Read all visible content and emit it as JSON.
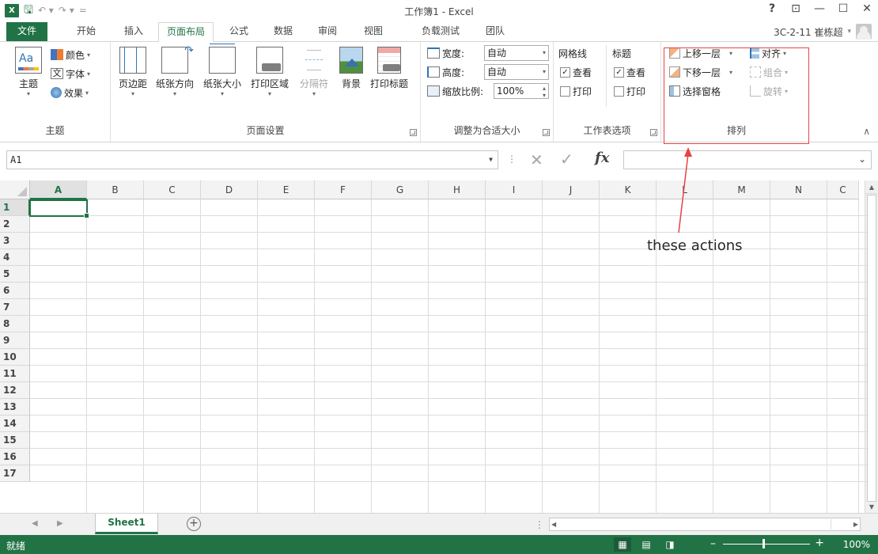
{
  "app": {
    "title": "工作簿1 - Excel",
    "help": "?",
    "accent": "#217346"
  },
  "qat": {
    "logo": "X",
    "save": "🖫",
    "undo": "↶ ▾",
    "redo": "↷ ▾",
    "customize": "="
  },
  "window": {
    "restore_ribbon": "⊡",
    "minimize": "—",
    "maximize": "☐",
    "close": "✕"
  },
  "tabs": [
    "文件",
    "开始",
    "插入",
    "页面布局",
    "公式",
    "数据",
    "审阅",
    "视图",
    "负载测试",
    "团队"
  ],
  "active_tab": "页面布局",
  "user": {
    "name": "3C-2-11  崔栋超",
    "caret": "▾"
  },
  "ribbon": {
    "themes": {
      "label": "主题",
      "theme_btn": "主题",
      "colors": "颜色",
      "fonts": "字体",
      "effects": "效果"
    },
    "page_setup": {
      "label": "页面设置",
      "margins": "页边距",
      "orientation": "纸张方向",
      "size": "纸张大小",
      "print_area": "打印区域",
      "breaks": "分隔符",
      "background": "背景",
      "print_titles": "打印标题"
    },
    "scale_to_fit": {
      "label": "调整为合适大小",
      "width_label": "宽度:",
      "width_value": "自动",
      "height_label": "高度:",
      "height_value": "自动",
      "scale_label": "缩放比例:",
      "scale_value": "100%"
    },
    "sheet_options": {
      "label": "工作表选项",
      "gridlines": "网格线",
      "headings": "标题",
      "view": "查看",
      "print": "打印",
      "gridlines_view": true,
      "gridlines_print": false,
      "headings_view": true,
      "headings_print": false
    },
    "arrange": {
      "label": "排列",
      "bring_forward": "上移一层",
      "send_backward": "下移一层",
      "selection_pane": "选择窗格",
      "align": "对齐",
      "group": "组合",
      "rotate": "旋转"
    }
  },
  "formula_bar": {
    "name_box": "A1",
    "formula": "",
    "fx": "fx",
    "cancel": "✕",
    "enter": "✓"
  },
  "grid": {
    "columns": [
      "A",
      "B",
      "C",
      "D",
      "E",
      "F",
      "G",
      "H",
      "I",
      "J",
      "K",
      "L",
      "M",
      "N",
      "C"
    ],
    "rows": [
      "1",
      "2",
      "3",
      "4",
      "5",
      "6",
      "7",
      "8",
      "9",
      "10",
      "11",
      "12",
      "13",
      "14",
      "15",
      "16",
      "17"
    ],
    "selected_cell": "A1"
  },
  "annotation": {
    "text": "these actions",
    "color": "#e84343"
  },
  "sheets": {
    "names": [
      "Sheet1"
    ],
    "active": "Sheet1",
    "add": "+"
  },
  "status": {
    "ready": "就绪",
    "zoom": "100%",
    "color": "#217346"
  }
}
